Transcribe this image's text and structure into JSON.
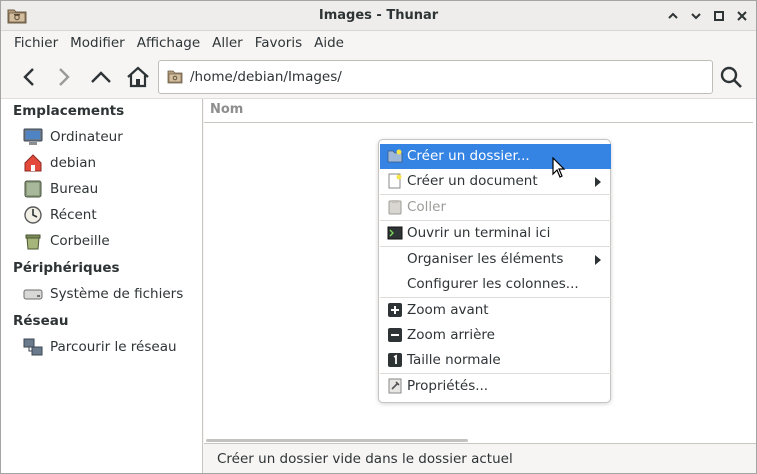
{
  "window": {
    "title": "Images - Thunar"
  },
  "titlebar_buttons": [
    {
      "name": "minimize-button",
      "glyph": "^"
    },
    {
      "name": "maximize-button",
      "glyph": "v"
    },
    {
      "name": "restore-button",
      "glyph": "◇"
    },
    {
      "name": "close-button",
      "glyph": "✕"
    }
  ],
  "menubar": {
    "items": [
      "Fichier",
      "Modifier",
      "Affichage",
      "Aller",
      "Favoris",
      "Aide"
    ]
  },
  "toolbar": {
    "icons": [
      "back-icon",
      "forward-icon",
      "up-icon",
      "home-icon",
      "search-icon"
    ],
    "path": "/home/debian/Images/"
  },
  "sidebar": {
    "sections": [
      {
        "title": "Emplacements",
        "items": [
          {
            "label": "Ordinateur",
            "icon": "computer-icon"
          },
          {
            "label": "debian",
            "icon": "home-folder-icon"
          },
          {
            "label": "Bureau",
            "icon": "desktop-icon"
          },
          {
            "label": "Récent",
            "icon": "recent-clock-icon"
          },
          {
            "label": "Corbeille",
            "icon": "trash-icon"
          }
        ]
      },
      {
        "title": "Périphériques",
        "items": [
          {
            "label": "Système de fichiers",
            "icon": "drive-icon"
          }
        ]
      },
      {
        "title": "Réseau",
        "items": [
          {
            "label": "Parcourir le réseau",
            "icon": "network-icon"
          }
        ]
      }
    ]
  },
  "main": {
    "column_header": "Nom"
  },
  "statusbar": {
    "text": "Créer un dossier vide dans le dossier actuel"
  },
  "context_menu": {
    "items": [
      {
        "label": "Créer un dossier...",
        "icon": "new-folder-icon",
        "highlighted": true
      },
      {
        "label": "Créer un document",
        "icon": "new-document-icon",
        "submenu": true
      },
      {
        "label": "Coller",
        "icon": "paste-icon",
        "disabled": true
      },
      {
        "label": "Ouvrir un terminal ici",
        "icon": "terminal-icon"
      },
      {
        "label": "Organiser les éléments",
        "submenu": true
      },
      {
        "label": "Configurer les colonnes..."
      },
      {
        "label": "Zoom avant",
        "icon": "zoom-in-icon"
      },
      {
        "label": "Zoom arrière",
        "icon": "zoom-out-icon"
      },
      {
        "label": "Taille normale",
        "icon": "zoom-normal-icon"
      },
      {
        "label": "Propriétés...",
        "icon": "properties-icon"
      }
    ]
  },
  "colors": {
    "accent": "#3584e4",
    "text": "#2e3436",
    "disabled": "#9b9d98"
  }
}
